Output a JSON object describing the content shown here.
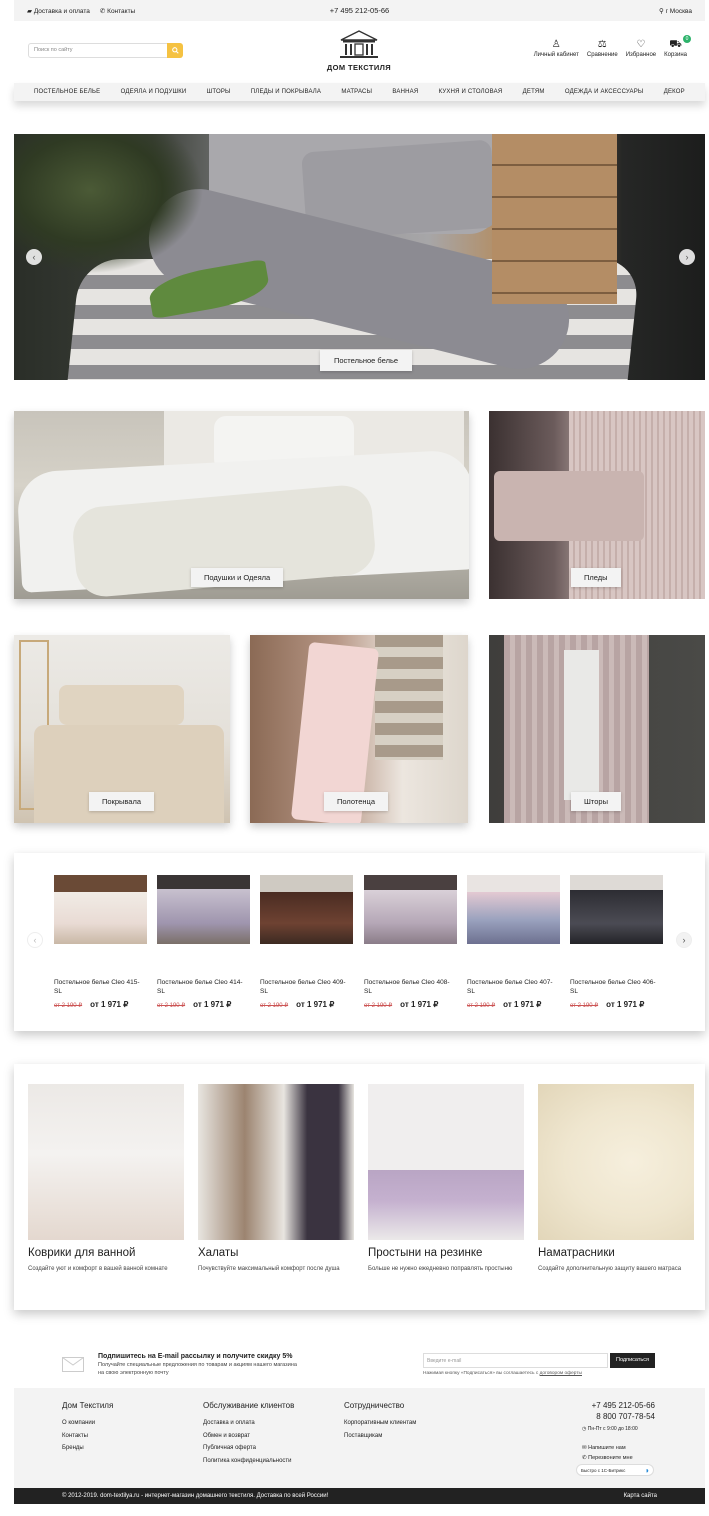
{
  "topbar": {
    "delivery": "Доставка и оплата",
    "contacts": "Контакты",
    "phone": "+7 495 212-05-66",
    "city": "г Москва"
  },
  "header": {
    "search_placeholder": "Поиск по сайту",
    "logo_text": "ДОМ ТЕКСТИЛЯ",
    "account": "Личный кабинет",
    "compare": "Сравнение",
    "favorites": "Избранное",
    "cart": "Корзина",
    "cart_count": "0"
  },
  "nav": [
    "ПОСТЕЛЬНОЕ БЕЛЬЕ",
    "ОДЕЯЛА И ПОДУШКИ",
    "ШТОРЫ",
    "ПЛЕДЫ И ПОКРЫВАЛА",
    "МАТРАСЫ",
    "ВАННАЯ",
    "КУХНЯ И СТОЛОВАЯ",
    "ДЕТЯМ",
    "ОДЕЖДА И АКСЕССУАРЫ",
    "ДЕКОР"
  ],
  "hero": {
    "label": "Постельное белье"
  },
  "categories": {
    "pillows": "Подушки и Одеяла",
    "plaids": "Пледы",
    "bedspreads": "Покрывала",
    "towels": "Полотенца",
    "curtains": "Шторы"
  },
  "products": [
    {
      "name": "Постельное белье Cleo 415-SL",
      "old": "от 2 190 ₽",
      "new": "от 1 971 ₽"
    },
    {
      "name": "Постельное белье Cleo 414-SL",
      "old": "от 2 190 ₽",
      "new": "от 1 971 ₽"
    },
    {
      "name": "Постельное белье Cleo 409-SL",
      "old": "от 2 190 ₽",
      "new": "от 1 971 ₽"
    },
    {
      "name": "Постельное белье Cleo 408-SL",
      "old": "от 2 190 ₽",
      "new": "от 1 971 ₽"
    },
    {
      "name": "Постельное белье Cleo 407-SL",
      "old": "от 2 190 ₽",
      "new": "от 1 971 ₽"
    },
    {
      "name": "Постельное белье Cleo 406-SL",
      "old": "от 2 190 ₽",
      "new": "от 1 971 ₽"
    }
  ],
  "features": [
    {
      "title": "Коврики для ванной",
      "desc": "Создайте уют и комфорт в вашей ванной комнате"
    },
    {
      "title": "Халаты",
      "desc": "Почувствуйте максимальный комфорт после душа"
    },
    {
      "title": "Простыни на резинке",
      "desc": "Больше не нужно ежедневно поправлять простыню"
    },
    {
      "title": "Наматрасники",
      "desc": "Создайте дополнительную защиту вашего матраса"
    }
  ],
  "subscribe": {
    "title": "Подпишитесь на E-mail рассылку и получите скидку 5%",
    "desc": "Получайте специальные предложения по товарам и акциям нашего магазина на свою электронную почту",
    "placeholder": "Введите e-mail",
    "button": "Подписаться",
    "note": "Нажимая кнопку «Подписаться» вы соглашаетесь с",
    "note_link": "договором оферты"
  },
  "footer": {
    "col1": {
      "title": "Дом Текстиля",
      "items": [
        "О компании",
        "Контакты",
        "Бренды"
      ]
    },
    "col2": {
      "title": "Обслуживание клиентов",
      "items": [
        "Доставка и оплата",
        "Обмен и возврат",
        "Публичная оферта",
        "Политика конфиденциальности"
      ]
    },
    "col3": {
      "title": "Сотрудничество",
      "items": [
        "Корпоративным клиентам",
        "Поставщикам"
      ]
    },
    "phone1": "+7 495 212-05-66",
    "phone2": "8 800 707-78-54",
    "hours": "Пн-Пт с 9:00 до 18:00",
    "write": "Напишите нам",
    "callback": "Перезвоните мне",
    "bitrix": "Быстро с 1С-Битрикс",
    "copyright": "© 2012-2019. dom-textilya.ru - интернет-магазин домашнего текстиля. Доставка по всей России!",
    "sitemap": "Карта сайта"
  }
}
